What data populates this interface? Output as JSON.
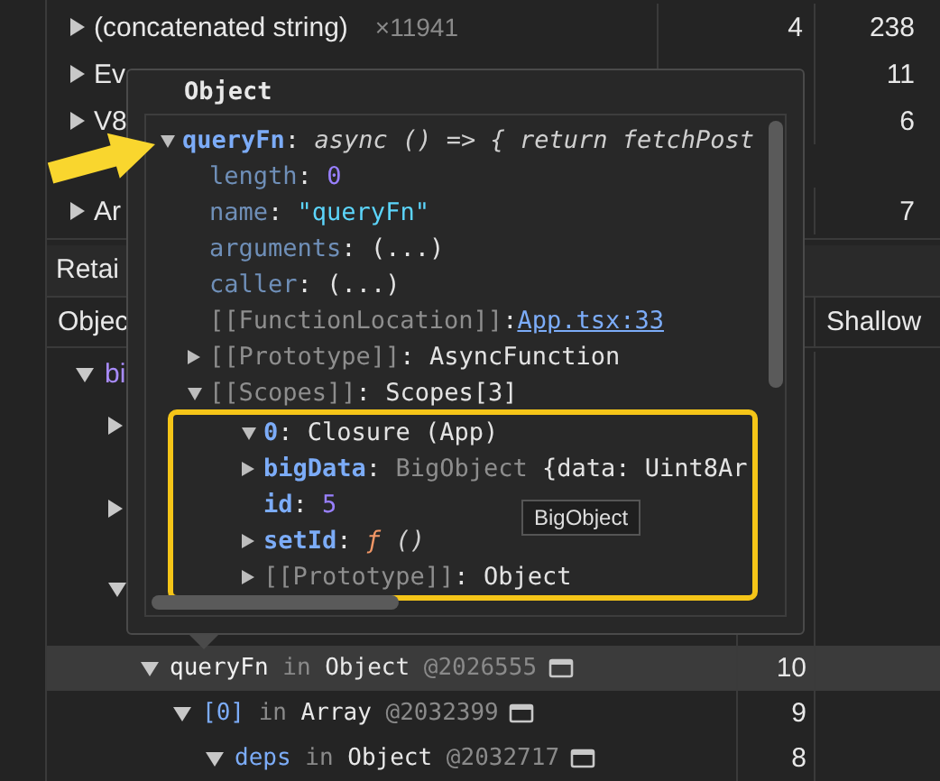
{
  "summary": {
    "rows": [
      {
        "name": "(concatenated string)",
        "count": "×11941",
        "distance": "4",
        "size": "238",
        "expanded": false
      },
      {
        "name": "Ev",
        "size": "11",
        "expanded": false
      },
      {
        "name": "V8",
        "size": "6",
        "expanded": false
      },
      {
        "name": "Ar",
        "size": "7",
        "expanded": false
      }
    ]
  },
  "retainers": {
    "tab": "Retai",
    "columns": [
      "Objec",
      "Shallow"
    ],
    "tree": [
      {
        "kind": "root",
        "name": "bi",
        "expanded": true,
        "selected": false,
        "children": [
          {
            "kind": "hidden",
            "expanded": false,
            "selected": false
          },
          {
            "kind": "hidden",
            "expanded": false,
            "selected": false
          },
          {
            "kind": "hidden",
            "expanded": true,
            "selected": false,
            "children": [
              {
                "kind": "edge",
                "edge": "queryFn",
                "connector": "in",
                "class_name": "Object",
                "id": "@2026555",
                "distance": "10",
                "expanded": true,
                "selected": true,
                "children": [
                  {
                    "kind": "edge",
                    "edge": "[0]",
                    "connector": "in",
                    "class_name": "Array",
                    "id": "@2032399",
                    "distance": "9",
                    "expanded": true,
                    "selected": false,
                    "children": [
                      {
                        "kind": "edge",
                        "edge": "deps",
                        "connector": "in",
                        "class_name": "Object",
                        "id": "@2032717",
                        "distance": "8",
                        "expanded": true,
                        "selected": false
                      }
                    ]
                  }
                ]
              }
            ]
          }
        ]
      }
    ]
  },
  "popover": {
    "title": "Object",
    "entries": [
      {
        "key": {
          "kind": "own",
          "text": "queryFn"
        },
        "sep": ":",
        "value": {
          "kind": "function",
          "text": "async () => { return fetchPost"
        },
        "expanded": true,
        "children": [
          {
            "key": {
              "kind": "nonenum",
              "text": "length"
            },
            "sep": ":",
            "value": {
              "kind": "number",
              "text": "0"
            }
          },
          {
            "key": {
              "kind": "nonenum",
              "text": "name"
            },
            "sep": ":",
            "value": {
              "kind": "string",
              "text": "\"queryFn\""
            }
          },
          {
            "key": {
              "kind": "nonenum",
              "text": "arguments"
            },
            "sep": ":",
            "value": {
              "kind": "plain",
              "text": "(...)"
            }
          },
          {
            "key": {
              "kind": "nonenum",
              "text": "caller"
            },
            "sep": ":",
            "value": {
              "kind": "plain",
              "text": "(...)"
            }
          },
          {
            "key": {
              "kind": "internal",
              "text": "[[FunctionLocation]]"
            },
            "sep": ":",
            "value": {
              "kind": "link",
              "text": "App.tsx:33"
            }
          },
          {
            "key": {
              "kind": "internal",
              "text": "[[Prototype]]"
            },
            "sep": ":",
            "value": {
              "kind": "plain",
              "text": "AsyncFunction"
            },
            "expanded": false
          },
          {
            "key": {
              "kind": "internal",
              "text": "[[Scopes]]"
            },
            "sep": ":",
            "value": {
              "kind": "plain",
              "text": "Scopes[3]"
            },
            "expanded": true,
            "children": [
              {
                "key": {
                  "kind": "own",
                  "text": "0"
                },
                "sep": ":",
                "value": {
                  "kind": "plain",
                  "text": "Closure (App)"
                },
                "expanded": true,
                "highlighted": true,
                "children": [
                  {
                    "key": {
                      "kind": "own",
                      "text": "bigData"
                    },
                    "sep": ":",
                    "class_name": "BigObject",
                    "value": {
                      "kind": "plain",
                      "text": "{data: Uint8Ar"
                    },
                    "expanded": false
                  },
                  {
                    "key": {
                      "kind": "own",
                      "text": "id"
                    },
                    "sep": ":",
                    "value": {
                      "kind": "number",
                      "text": "5"
                    }
                  },
                  {
                    "key": {
                      "kind": "own",
                      "text": "setId"
                    },
                    "sep": ":",
                    "sign": "ƒ",
                    "value": {
                      "kind": "function",
                      "text": "()"
                    },
                    "expanded": false
                  },
                  {
                    "key": {
                      "kind": "internal",
                      "text": "[[Prototype]]"
                    },
                    "sep": ":",
                    "value": {
                      "kind": "plain",
                      "text": "Object"
                    },
                    "expanded": false
                  }
                ]
              }
            ]
          }
        ]
      }
    ]
  },
  "tooltip": {
    "text": "BigObject"
  }
}
